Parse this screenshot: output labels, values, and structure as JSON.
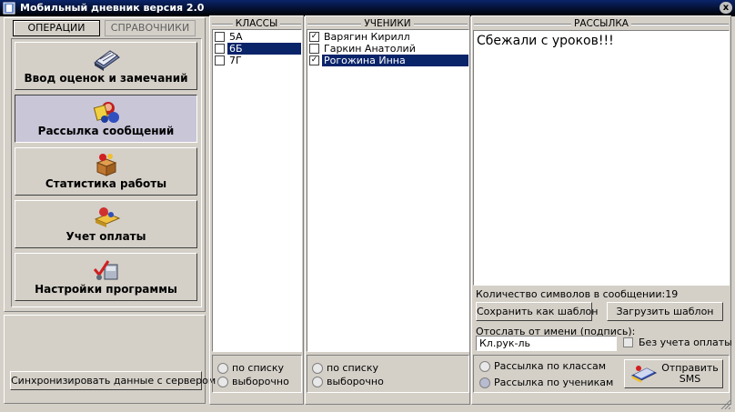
{
  "window": {
    "title": "Мобильный дневник версия 2.0",
    "close_glyph": "x"
  },
  "tabs": {
    "operations": "ОПЕРАЦИИ",
    "references": "СПРАВОЧНИКИ"
  },
  "nav": [
    {
      "label": "Ввод оценок и замечаний",
      "icon": "journal-icon"
    },
    {
      "label": "Рассылка сообщений",
      "icon": "messaging-icon",
      "selected": true
    },
    {
      "label": "Статистика работы",
      "icon": "statistics-box-icon"
    },
    {
      "label": "Учет оплаты",
      "icon": "payment-icon"
    },
    {
      "label": "Настройки программы",
      "icon": "settings-tools-icon"
    }
  ],
  "sync_button": "Синхронизировать данные с сервером",
  "classes": {
    "header": "КЛАССЫ",
    "items": [
      {
        "label": "5А",
        "checked": false,
        "selected": false
      },
      {
        "label": "6Б",
        "checked": false,
        "selected": true
      },
      {
        "label": "7Г",
        "checked": false,
        "selected": false
      }
    ],
    "radio_list": "по списку",
    "radio_select": "выборочно"
  },
  "students": {
    "header": "УЧЕНИКИ",
    "items": [
      {
        "label": "Варягин Кирилл",
        "checked": true,
        "selected": false
      },
      {
        "label": "Гаркин Анатолий",
        "checked": false,
        "selected": false
      },
      {
        "label": "Рогожина Инна",
        "checked": true,
        "selected": true
      }
    ],
    "radio_list": "по списку",
    "radio_select": "выборочно"
  },
  "mailing": {
    "header": "РАССЫЛКА",
    "message": "Сбежали с уроков!!!",
    "char_count_label": "Количество символов в сообщении:",
    "char_count": "19",
    "save_template": "Сохранить как шаблон",
    "load_template": "Загрузить шаблон",
    "sender_label": "Отослать от имени (подпись):",
    "sender_value": "Кл.рук-ль",
    "no_payment_label": "Без учета оплаты",
    "radio_by_classes": "Рассылка по классам",
    "radio_by_students": "Рассылка по ученикам",
    "send_sms": "Отправить",
    "send_sms_2": "SMS"
  },
  "colors": {
    "selection": "#0a246a",
    "face": "#d4d0c8",
    "selected_nav": "#c9c6d8"
  }
}
